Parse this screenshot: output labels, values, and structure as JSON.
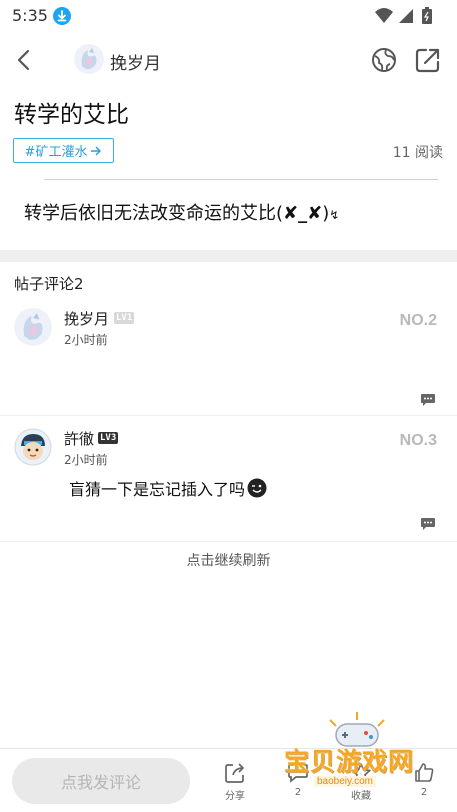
{
  "status_bar": {
    "time": "5:35"
  },
  "nav": {
    "author": "挽岁月"
  },
  "post": {
    "title": "转学的艾比",
    "tag": "#矿工灌水",
    "read_count": "11 阅读",
    "body_text": "转学后依旧无法改变命运的艾比(",
    "body_emoticon": "✘_✘",
    "body_suffix": ")",
    "body_tail": "↯"
  },
  "comments_section": {
    "heading": "帖子评论2",
    "items": [
      {
        "name": "挽岁月",
        "level": "LV1",
        "time": "2小时前",
        "floor": "NO.2",
        "text": ""
      },
      {
        "name": "許徹",
        "level": "LV3",
        "time": "2小时前",
        "floor": "NO.3",
        "text": "盲猜一下是忘记插入了吗"
      }
    ],
    "load_more": "点击继续刷新"
  },
  "bottom_bar": {
    "comment_button": "点我发评论",
    "share_label": "分享",
    "reply_count": "2",
    "collect_label": "收藏",
    "like_count": "2"
  },
  "watermark": {
    "title": "宝贝游戏网",
    "url": "baobeiy.com"
  },
  "colors": {
    "accent": "#2a9fd8",
    "floor_grey": "#b9b9b9",
    "separator": "#efefef"
  }
}
